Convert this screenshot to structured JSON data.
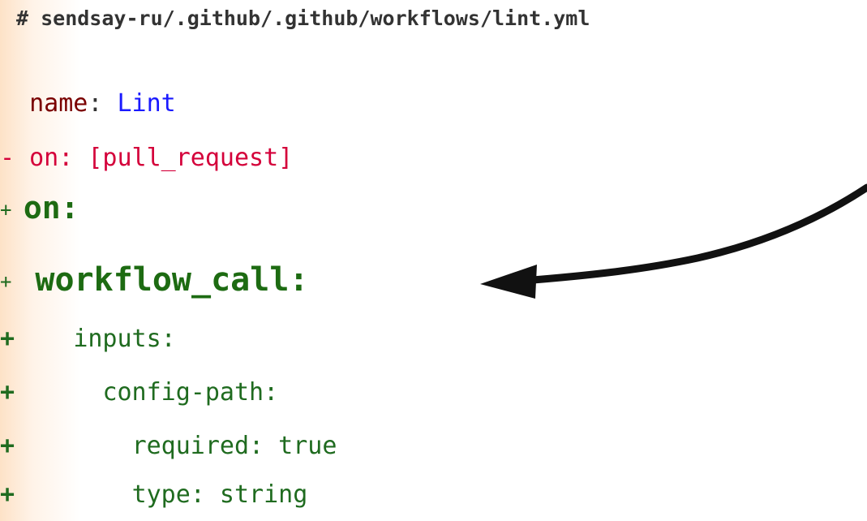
{
  "header": {
    "file_path": "# sendsay-ru/.github/.github/workflows/lint.yml"
  },
  "diff": {
    "name_line": {
      "marker": "  ",
      "key": "name",
      "sep": ": ",
      "value": "Lint"
    },
    "removed_line": {
      "marker": "- ",
      "text": "on: [pull_request]"
    },
    "on_line": {
      "marker": "+ ",
      "text": "on:"
    },
    "workflow_line": {
      "marker": "+  ",
      "text": "workflow_call:"
    },
    "inputs_line": {
      "marker": "+    ",
      "text": "inputs:"
    },
    "config_line": {
      "marker": "+      ",
      "text": "config-path:"
    },
    "required_line": {
      "marker": "+        ",
      "text": "required: true"
    },
    "type_line": {
      "marker": "+        ",
      "text": "type: string"
    }
  },
  "annotation": {
    "arrow_icon": "curved-arrow-icon",
    "arrow_color": "#111111"
  },
  "colors": {
    "added": "#1d6b12",
    "removed": "#d4003a",
    "key": "#7a0000",
    "value": "#1a1aff"
  }
}
